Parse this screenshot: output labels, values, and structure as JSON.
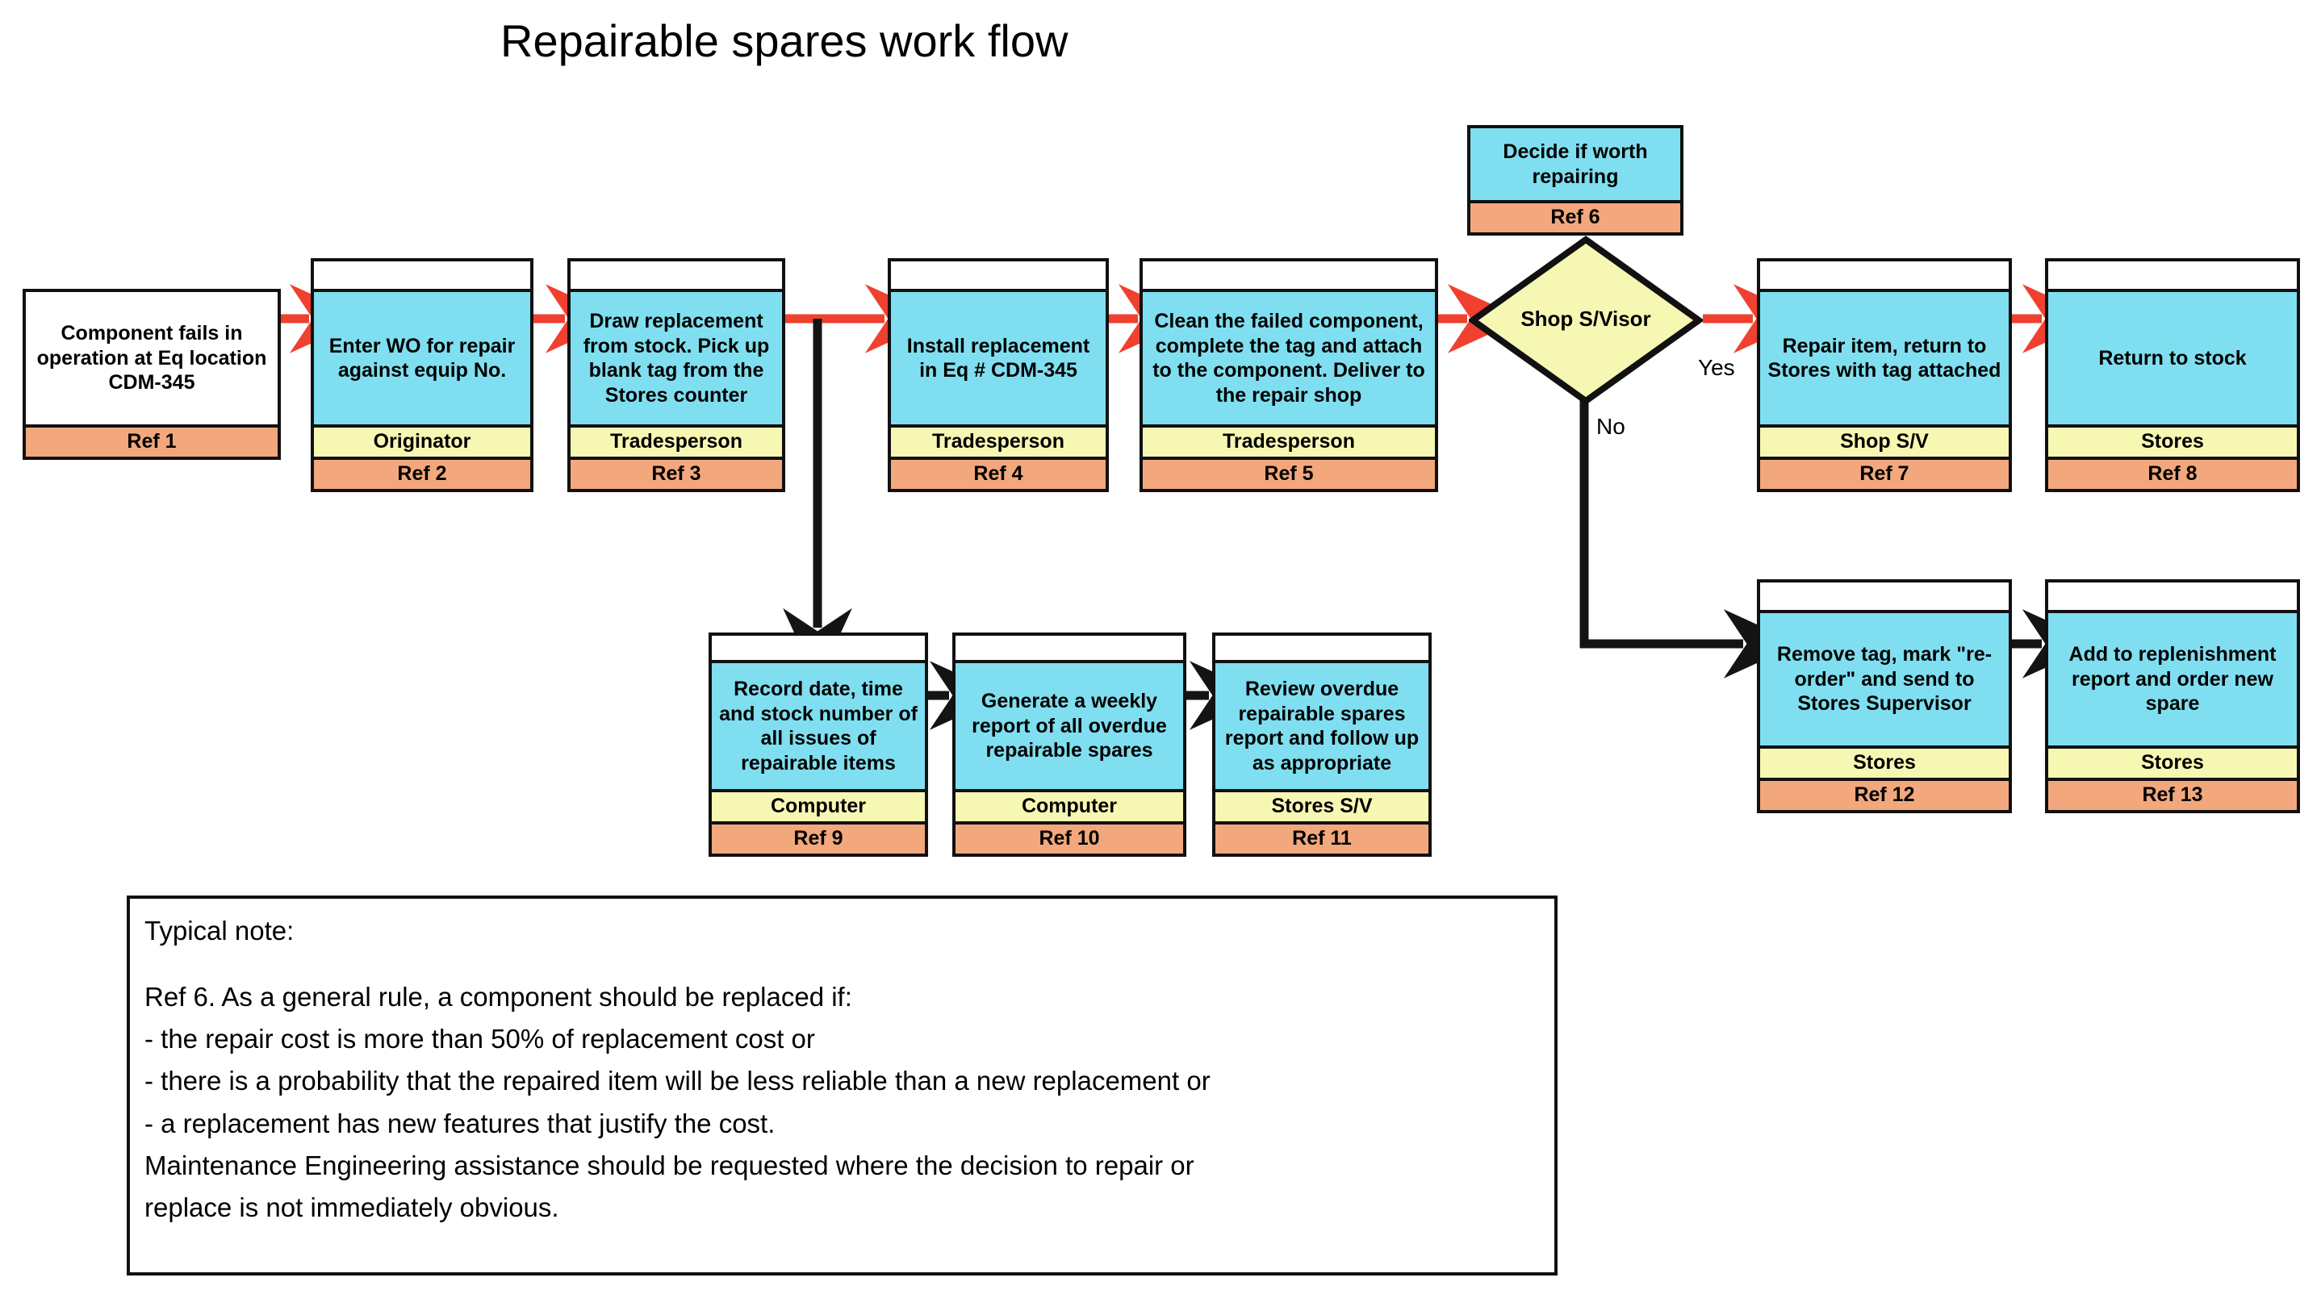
{
  "title": "Repairable spares work flow",
  "colors": {
    "process_fill": "#7fdff0",
    "role_fill": "#f7f7b4",
    "ref_fill": "#f2a87c",
    "decision_fill": "#f7f7b4",
    "red_arrow": "#f04030",
    "black_arrow": "#111111",
    "outline": "#111111",
    "background": "#ffffff"
  },
  "nodes": {
    "ref1": {
      "text": "Component fails in operation at Eq location CDM-345",
      "role": "",
      "ref": "Ref 1"
    },
    "ref2": {
      "text": "Enter WO  for repair against equip No.",
      "role": "Originator",
      "ref": "Ref 2"
    },
    "ref3": {
      "text": "Draw replacement from stock. Pick up blank tag from the Stores counter",
      "role": "Tradesperson",
      "ref": "Ref 3"
    },
    "ref4": {
      "text": "Install replacement in Eq # CDM-345",
      "role": "Tradesperson",
      "ref": "Ref 4"
    },
    "ref5": {
      "text": "Clean the failed component, complete the tag and attach to the component. Deliver to the repair shop",
      "role": "Tradesperson",
      "ref": "Ref 5"
    },
    "ref6": {
      "text": "Decide if worth repairing",
      "role": "",
      "ref": "Ref 6"
    },
    "ref7": {
      "text": "Repair item, return to Stores with tag attached",
      "role": "Shop S/V",
      "ref": "Ref 7"
    },
    "ref8": {
      "text": "Return to stock",
      "role": "Stores",
      "ref": "Ref 8"
    },
    "ref9": {
      "text": "Record date, time and stock number of all issues of repairable items",
      "role": "Computer",
      "ref": "Ref 9"
    },
    "ref10": {
      "text": "Generate a weekly report of all overdue repairable spares",
      "role": "Computer",
      "ref": "Ref 10"
    },
    "ref11": {
      "text": "Review overdue repairable spares report and follow up as appropriate",
      "role": "Stores S/V",
      "ref": "Ref 11"
    },
    "ref12": {
      "text": "Remove tag, mark \"re-order\" and send to Stores Supervisor",
      "role": "Stores",
      "ref": "Ref 12"
    },
    "ref13": {
      "text": "Add to replenishment report and order new spare",
      "role": "Stores",
      "ref": "Ref 13"
    }
  },
  "decision": {
    "label": "Shop S/Visor",
    "yes_label": "Yes",
    "no_label": "No"
  },
  "note": {
    "heading": "Typical note:",
    "lines": [
      "Ref 6. As a general rule, a component should be replaced if:",
      "- the repair cost is more than 50% of replacement cost or",
      "- there is a probability that the repaired item will be less reliable than a new replacement or",
      "- a replacement has new features that justify the cost.",
      "Maintenance Engineering assistance should be requested where the decision to repair or",
      "replace is not immediately obvious."
    ]
  },
  "chart_data": {
    "type": "diagram",
    "title": "Repairable spares work flow",
    "flow_main": [
      "Ref 1",
      "Ref 2",
      "Ref 3",
      "Ref 4",
      "Ref 5",
      "Shop S/Visor"
    ],
    "flow_yes": [
      "Shop S/Visor",
      "Ref 7",
      "Ref 8"
    ],
    "flow_no": [
      "Shop S/Visor",
      "Ref 12",
      "Ref 13"
    ],
    "flow_branch": [
      "Ref 3",
      "Ref 9",
      "Ref 10",
      "Ref 11"
    ],
    "decision_input": "Ref 6"
  }
}
